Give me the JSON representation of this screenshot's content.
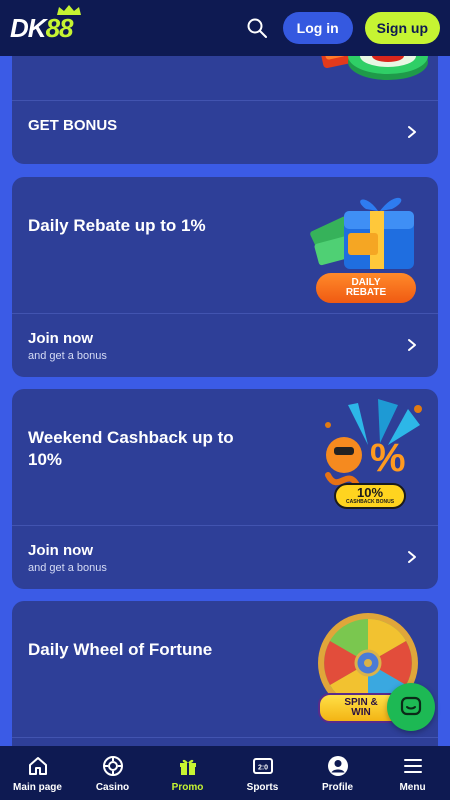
{
  "header": {
    "logo_left": "DK",
    "logo_right": "88",
    "login_label": "Log in",
    "signup_label": "Sign up"
  },
  "promos": [
    {
      "title": "",
      "cta_title": "GET BONUS",
      "cta_sub": ""
    },
    {
      "title": "Daily Rebate up to 1%",
      "badge": "DAILY REBATE",
      "badge_line1": "DAILY",
      "badge_line2": "REBATE",
      "cta_title": "Join now",
      "cta_sub": "and get a bonus"
    },
    {
      "title": "Weekend Cashback up to 10%",
      "badge_big": "10%",
      "badge_small": "CASHBACK BONUS",
      "cta_title": "Join now",
      "cta_sub": "and get a bonus"
    },
    {
      "title": "Daily Wheel of Fortune",
      "badge_line1": "SPIN &",
      "badge_line2": "WIN"
    }
  ],
  "nav": [
    {
      "label": "Main page",
      "icon": "home-icon"
    },
    {
      "label": "Casino",
      "icon": "casino-chip-icon"
    },
    {
      "label": "Promo",
      "icon": "gift-icon",
      "active": true
    },
    {
      "label": "Sports",
      "icon": "scoreboard-icon"
    },
    {
      "label": "Profile",
      "icon": "user-icon"
    },
    {
      "label": "Menu",
      "icon": "hamburger-icon"
    }
  ],
  "colors": {
    "header": "#0e1a52",
    "background": "#3b5be6",
    "card": "#2e3f98",
    "accent": "#c6f432",
    "login": "#3559e0",
    "chat": "#1db954"
  }
}
